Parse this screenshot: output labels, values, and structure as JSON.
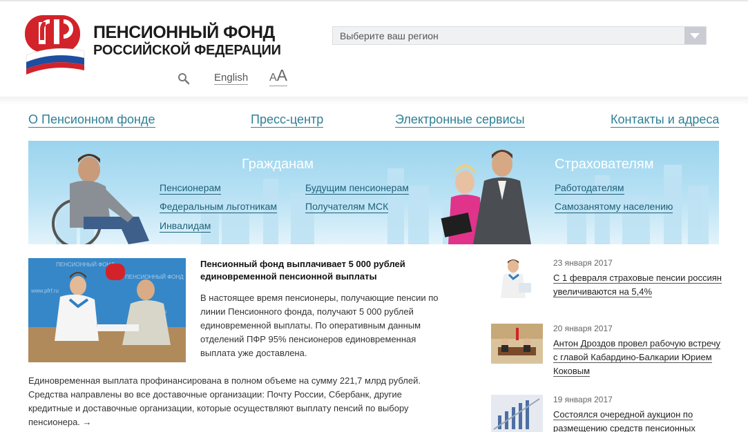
{
  "header": {
    "org_line1": "ПЕНСИОННЫЙ ФОНД",
    "org_line2": "РОССИЙСКОЙ ФЕДЕРАЦИИ",
    "language_link": "English",
    "font_size_small": "A",
    "font_size_big": "A",
    "region_select": "Выберите ваш регион"
  },
  "nav": {
    "about": "О Пенсионном фонде",
    "press": "Пресс-центр",
    "services": "Электронные сервисы",
    "contacts": "Контакты и адреса"
  },
  "banner": {
    "citizens": {
      "heading": "Гражданам",
      "links": [
        "Пенсионерам",
        "Будущим пенсионерам",
        "Федеральным льготникам",
        "Получателям МСК",
        "Инвалидам"
      ]
    },
    "insurers": {
      "heading": "Страхователям",
      "links": [
        "Работодателям",
        "Самозанятому населению"
      ]
    }
  },
  "lead_news": {
    "title": "Пенсионный фонд выплачивает 5 000 рублей единовременной пенсионной выплаты",
    "paragraph1": "В настоящее время пенсионеры, получающие пенсии по линии Пенсионного фонда, получают 5 000 рублей единовременной выплаты. По оперативным данным отделений ПФР 95% пенсионеров единовременная выплата уже доставлена.",
    "paragraph2": "Единовременная выплата профинансирована в полном объеме на сумму 221,7 млрд рублей. Средства направлены во все доставочные организации: Почту России, Сбербанк, другие кредитные и доставочные организации, которые осуществляют выплату пенсий по выбору пенсионера. →"
  },
  "side_news": [
    {
      "date": "23 января 2017",
      "headline": "С 1 февраля страховые пенсии россиян увеличиваются на 5,4%"
    },
    {
      "date": "20 января 2017",
      "headline": "Антон Дроздов провел рабочую встречу с главой Кабардино-Балкарии Юрием Коковым"
    },
    {
      "date": "19 января 2017",
      "headline": "Состоялся очередной аукцион по размещению средств пенсионных"
    }
  ],
  "colors": {
    "nav_link": "#2f7f96",
    "logo_red": "#d2232a",
    "flag_blue": "#1f4da0",
    "banner_sky": "#9bd4ee"
  },
  "icons": [
    "pfr-logo-icon",
    "search-icon",
    "dropdown-arrow-icon"
  ]
}
